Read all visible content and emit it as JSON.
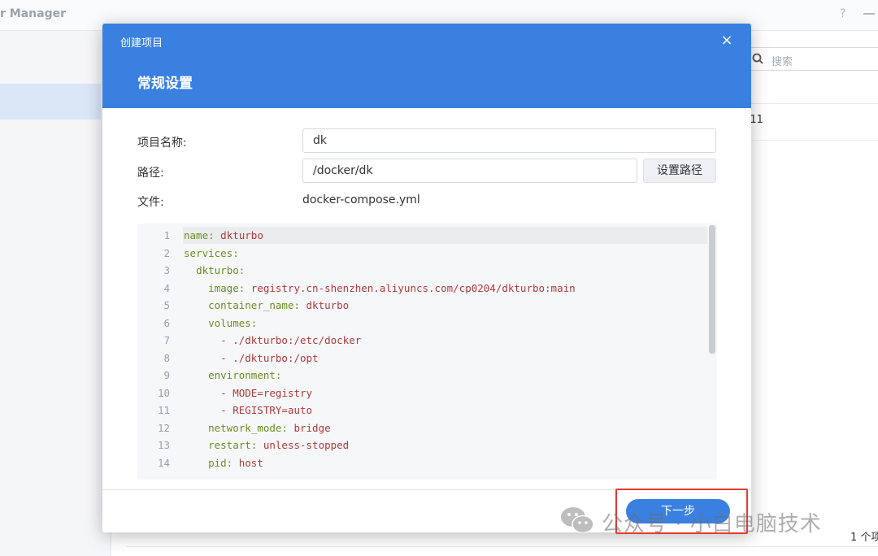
{
  "background": {
    "app_title": "r Manager",
    "help_label": "?",
    "search_placeholder": "搜索",
    "row_text": ":11",
    "item_count": "1 个项"
  },
  "dialog": {
    "title": "创建项目",
    "subtitle": "常规设置",
    "close_label": "×",
    "form": {
      "name_label": "项目名称:",
      "name_value": "dk",
      "path_label": "路径:",
      "path_value": "/docker/dk",
      "set_path_button": "设置路径",
      "file_label": "文件:",
      "file_value": "docker-compose.yml"
    },
    "code_lines": [
      {
        "n": "1",
        "indent": "",
        "key": "name:",
        "value": " dkturbo"
      },
      {
        "n": "2",
        "indent": "",
        "key": "services:",
        "value": ""
      },
      {
        "n": "3",
        "indent": "  ",
        "key": "dkturbo:",
        "value": ""
      },
      {
        "n": "4",
        "indent": "    ",
        "key": "image:",
        "value": " registry.cn-shenzhen.aliyuncs.com/cp0204/dkturbo:main"
      },
      {
        "n": "5",
        "indent": "    ",
        "key": "container_name:",
        "value": " dkturbo"
      },
      {
        "n": "6",
        "indent": "    ",
        "key": "volumes:",
        "value": ""
      },
      {
        "n": "7",
        "indent": "      ",
        "key": "",
        "value": "- ./dkturbo:/etc/docker"
      },
      {
        "n": "8",
        "indent": "      ",
        "key": "",
        "value": "- ./dkturbo:/opt"
      },
      {
        "n": "9",
        "indent": "    ",
        "key": "environment:",
        "value": ""
      },
      {
        "n": "10",
        "indent": "      ",
        "key": "",
        "value": "- MODE=registry"
      },
      {
        "n": "11",
        "indent": "      ",
        "key": "",
        "value": "- REGISTRY=auto"
      },
      {
        "n": "12",
        "indent": "    ",
        "key": "network_mode:",
        "value": " bridge"
      },
      {
        "n": "13",
        "indent": "    ",
        "key": "restart:",
        "value": " unless-stopped"
      },
      {
        "n": "14",
        "indent": "    ",
        "key": "pid:",
        "value": " host"
      }
    ],
    "next_button": "下一步"
  },
  "watermark": {
    "text": "公众号 · 小白电脑技术"
  },
  "colors": {
    "accent": "#3a80e0",
    "highlight_box": "#e53935"
  }
}
